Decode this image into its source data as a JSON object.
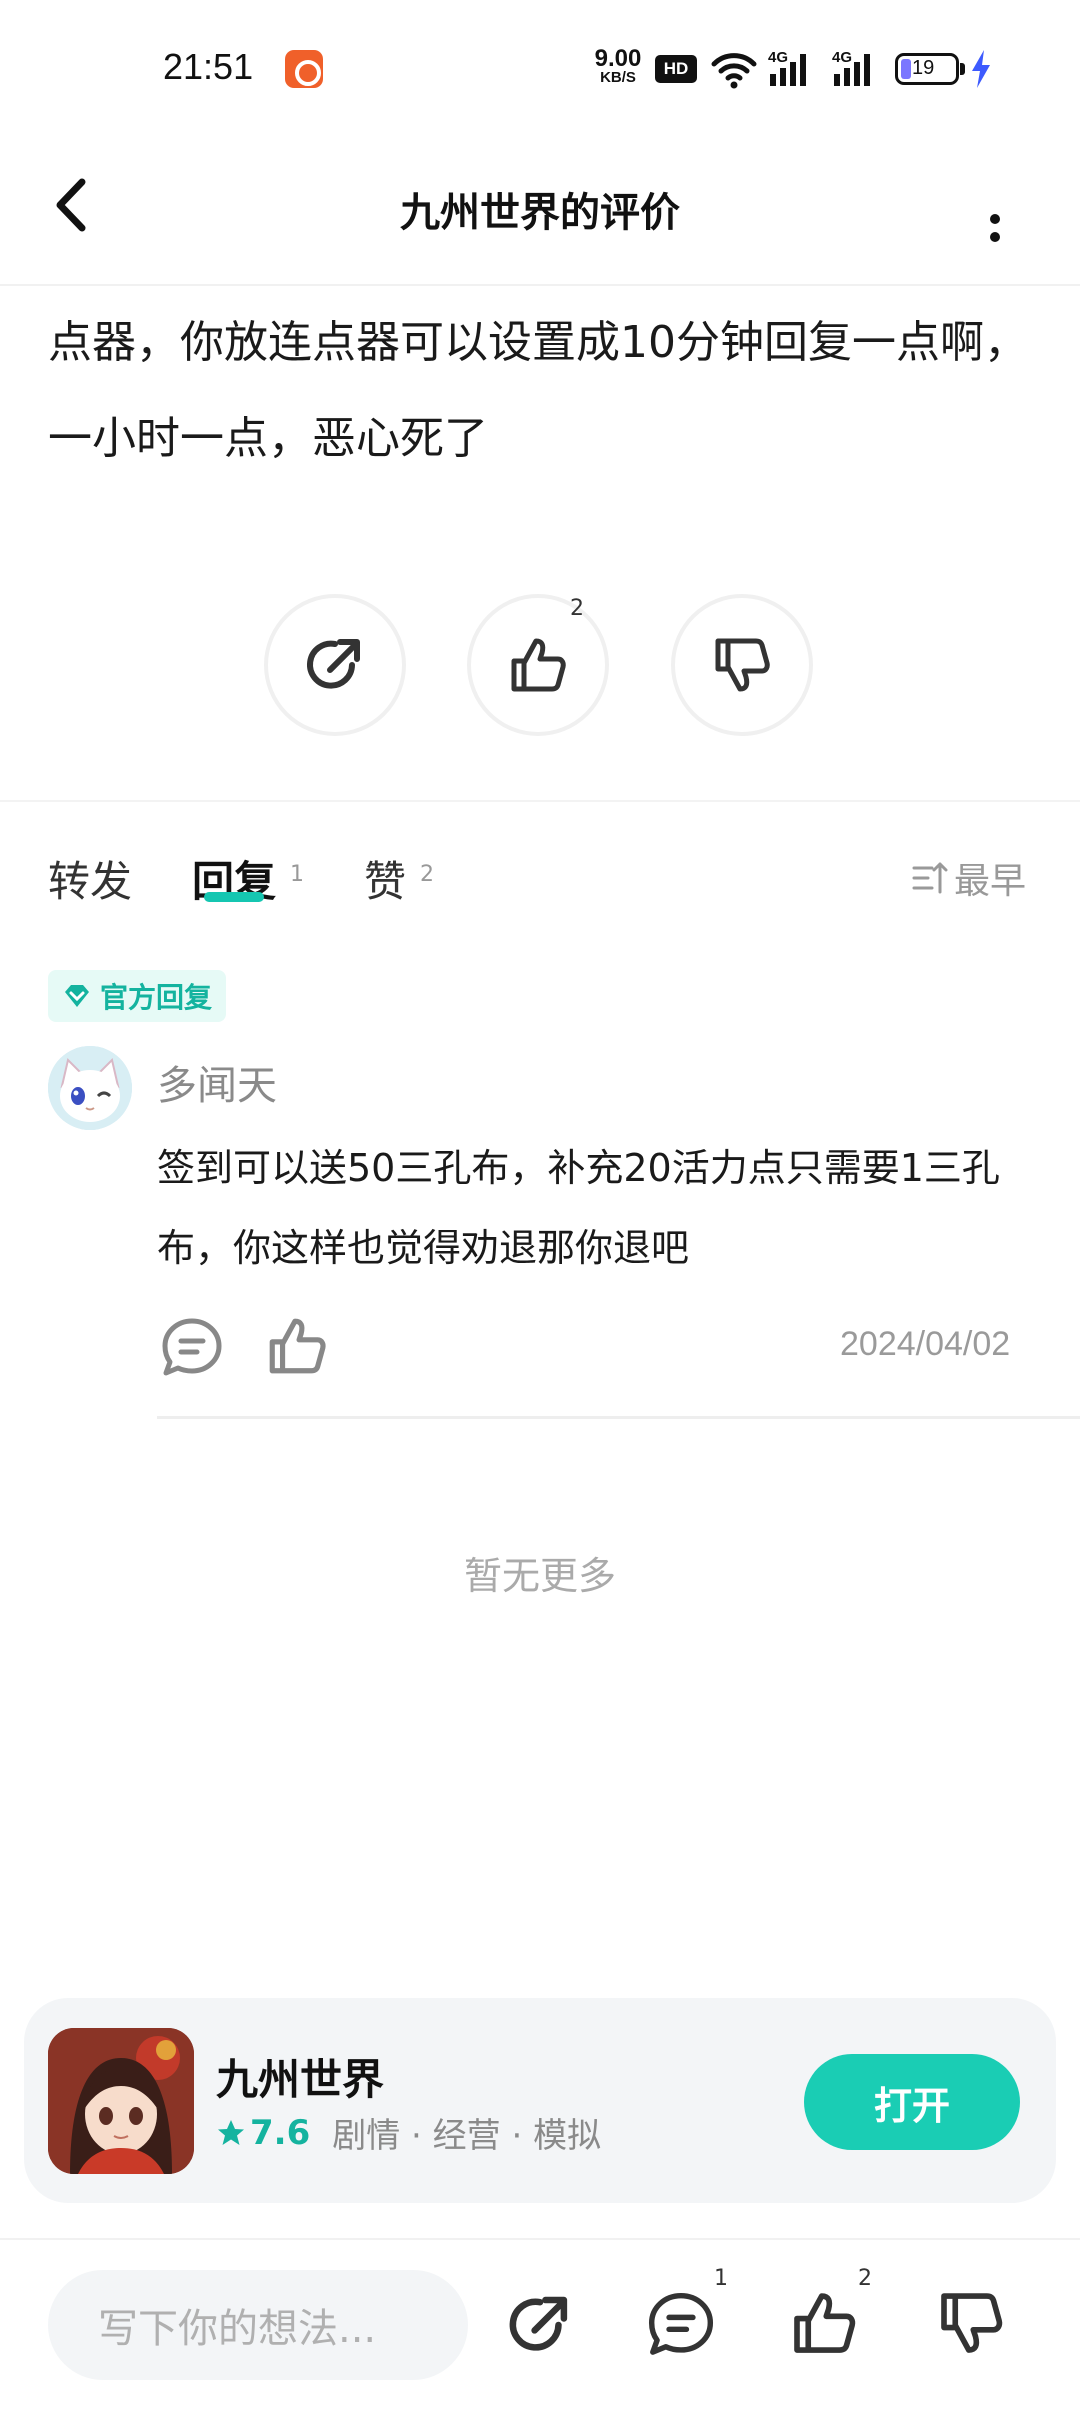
{
  "status_bar": {
    "time": "21:51",
    "speed_value": "9.00",
    "speed_unit": "KB/S",
    "hd_label": "HD",
    "network_1": "4G",
    "network_2": "4G",
    "battery_level": "19"
  },
  "header": {
    "title": "九州世界的评价"
  },
  "review": {
    "text": "点器，你放连点器可以设置成10分钟回复一点啊，一小时一点，恶心死了",
    "like_count": "2"
  },
  "tabs": [
    {
      "label": "转发",
      "count": ""
    },
    {
      "label": "回复",
      "count": "1"
    },
    {
      "label": "赞",
      "count": "2"
    }
  ],
  "sort_label": "最早",
  "reply": {
    "badge": "官方回复",
    "username": "多闻天",
    "text": "签到可以送50三孔布，补充20活力点只需要1三孔布，你这样也觉得劝退那你退吧",
    "date": "2024/04/02"
  },
  "no_more_text": "暂无更多",
  "game_card": {
    "name": "九州世界",
    "score": "7.6",
    "tags": "剧情 · 经营 · 模拟",
    "open_label": "打开"
  },
  "bottom_bar": {
    "input_placeholder": "写下你的想法...",
    "comment_count": "1",
    "like_count": "2"
  },
  "colors": {
    "accent": "#1acdb4",
    "accent_text": "#14b39f",
    "battery": "#7b77ff",
    "charging": "#3d5afe"
  }
}
